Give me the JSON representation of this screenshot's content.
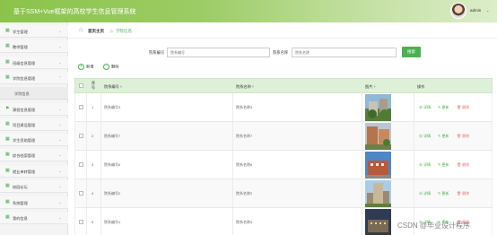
{
  "header": {
    "title": "基于SSM+Vue框架的高校学生信息管理系统",
    "username": "admin",
    "caret": "⌄"
  },
  "sidebar": {
    "items": [
      {
        "label": "学生管理",
        "icon": "grid-icon"
      },
      {
        "label": "教师管理",
        "icon": "grid-icon"
      },
      {
        "label": "班级信息管理",
        "icon": "grid-icon"
      },
      {
        "label": "学院信息管理",
        "icon": "grid-icon"
      },
      {
        "label": "课程信息管理",
        "icon": "flag-icon"
      },
      {
        "label": "项目建设管理",
        "icon": "grid-icon"
      },
      {
        "label": "学生资助管理",
        "icon": "grid-icon"
      },
      {
        "label": "综合档案管理",
        "icon": "grid-icon"
      },
      {
        "label": "就业单转管理",
        "icon": "grid-icon"
      },
      {
        "label": "校园论坛",
        "icon": "grid-icon"
      },
      {
        "label": "系统管理",
        "icon": "grid-icon"
      },
      {
        "label": "我的信息",
        "icon": "grid-icon"
      }
    ],
    "submenu_label": "学院信息"
  },
  "breadcrumb": {
    "home": "首页主页",
    "separator": "▷",
    "current": "学院信息"
  },
  "search": {
    "field1_label": "院系编号",
    "field1_placeholder": "院系编号",
    "field2_label": "院系名称",
    "field2_placeholder": "院系名称",
    "button": "搜索"
  },
  "actions": {
    "add": "新增",
    "delete": "删除"
  },
  "table": {
    "headers": {
      "index": "序号",
      "code": "院系编号 ÷",
      "name": "院系名称 ÷",
      "image": "图片 ÷",
      "ops": "操作"
    },
    "rows": [
      {
        "index": "1",
        "code": "院系编号3",
        "name": "院系名称3"
      },
      {
        "index": "2",
        "code": "院系编号7",
        "name": "院系名称7"
      },
      {
        "index": "3",
        "code": "院系编号6",
        "name": "院系名称6"
      },
      {
        "index": "4",
        "code": "院系编号2",
        "name": "院系名称2"
      },
      {
        "index": "5",
        "code": "院系编号4",
        "name": "院系名称4"
      }
    ],
    "op_labels": {
      "detail": "详情",
      "edit": "更新",
      "remove": "删除"
    }
  },
  "watermark": "CSDN @毕业设计程序"
}
